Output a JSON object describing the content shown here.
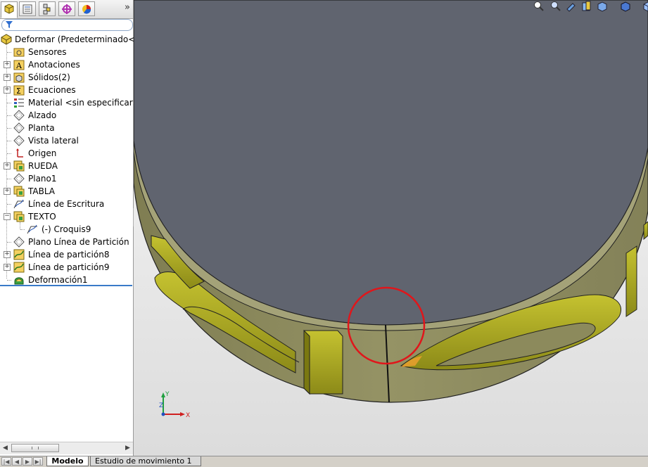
{
  "feature_tree": {
    "root_label": "Deformar  (Predeterminado<<P",
    "items": [
      {
        "label": "Sensores",
        "icon": "sensor-folder-icon",
        "expandable": false
      },
      {
        "label": "Anotaciones",
        "icon": "annotation-icon",
        "expandable": true
      },
      {
        "label": "Sólidos(2)",
        "icon": "solid-bodies-icon",
        "expandable": true
      },
      {
        "label": "Ecuaciones",
        "icon": "equations-icon",
        "expandable": true
      },
      {
        "label": "Material <sin especificar>",
        "icon": "material-icon",
        "expandable": false
      },
      {
        "label": "Alzado",
        "icon": "plane-icon",
        "expandable": false
      },
      {
        "label": "Planta",
        "icon": "plane-icon",
        "expandable": false
      },
      {
        "label": "Vista lateral",
        "icon": "plane-icon",
        "expandable": false
      },
      {
        "label": "Origen",
        "icon": "origin-icon",
        "expandable": false
      },
      {
        "label": "RUEDA",
        "icon": "feature-icon",
        "expandable": true
      },
      {
        "label": "Plano1",
        "icon": "plane-icon",
        "expandable": false
      },
      {
        "label": "TABLA",
        "icon": "feature-icon",
        "expandable": true
      },
      {
        "label": "Línea de Escritura",
        "icon": "sketch-icon",
        "expandable": false
      },
      {
        "label": "TEXTO",
        "icon": "feature-icon",
        "expandable": true,
        "expanded": true
      },
      {
        "label": "(-) Croquis9",
        "icon": "sketch-icon",
        "expandable": false,
        "child": true
      },
      {
        "label": "Plano Línea de Partición",
        "icon": "plane-icon",
        "expandable": false
      },
      {
        "label": "Línea de partición8",
        "icon": "split-line-icon",
        "expandable": true
      },
      {
        "label": "Línea de partición9",
        "icon": "split-line-icon",
        "expandable": true
      },
      {
        "label": "Deformación1",
        "icon": "deform-icon",
        "expandable": false
      }
    ]
  },
  "pane_tabs": [
    {
      "name": "featuremanager-tab",
      "icon": "feature-tree-icon"
    },
    {
      "name": "propertymanager-tab",
      "icon": "property-manager-icon"
    },
    {
      "name": "configurationmanager-tab",
      "icon": "configuration-icon"
    },
    {
      "name": "dimxpert-tab",
      "icon": "dimxpert-icon"
    },
    {
      "name": "display-manager-tab",
      "icon": "appearance-icon"
    }
  ],
  "pane_tabs_more": "»",
  "bottom_tabs": {
    "model": "Modelo",
    "motion_study": "Estudio de movimiento 1"
  },
  "view_toolbar_icons": [
    "zoom-to-fit-icon",
    "zoom-area-icon",
    "previous-view-icon",
    "section-view-icon",
    "view-orientation-icon",
    "display-style-icon",
    "hide-show-icon",
    "edit-appearance-icon",
    "apply-scene-icon",
    "view-settings-icon"
  ],
  "triad_labels": {
    "x": "X",
    "y": "Y",
    "z": "Z"
  },
  "colors": {
    "model_face": "#5f6370",
    "model_body": "#8c8a5c",
    "lettering": "#a8a520",
    "highlight_circle": "#e0161b",
    "selection_blue": "#3a7ac8"
  }
}
